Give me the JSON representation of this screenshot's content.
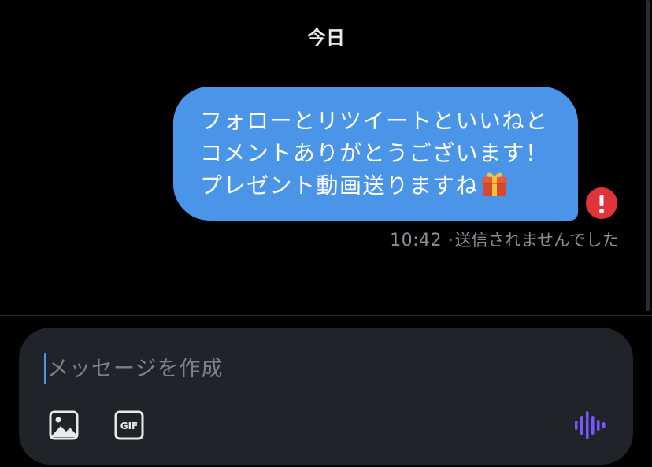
{
  "conversation": {
    "date_divider": "今日",
    "messages": [
      {
        "lines": [
          "フォローとリツイートといいねと",
          "コメントありがとうございます！",
          "プレゼント動画送りますね"
        ],
        "emoji": "gift",
        "time": "10:42",
        "status_separator": "·",
        "status": "送信されませんでした",
        "status_icon": "error-exclamation-icon"
      }
    ]
  },
  "composer": {
    "placeholder": "メッセージを作成",
    "value": "",
    "image_button_icon": "image-icon",
    "gif_button_label": "GIF",
    "voice_button_icon": "voice-waveform-icon"
  },
  "colors": {
    "background": "#000000",
    "bubble": "#4a95e8",
    "error": "#e0343a",
    "composer_background": "#202327",
    "accent_voice": "#7856ff",
    "icon": "#e7e9ea",
    "muted_text": "#8b9096"
  }
}
